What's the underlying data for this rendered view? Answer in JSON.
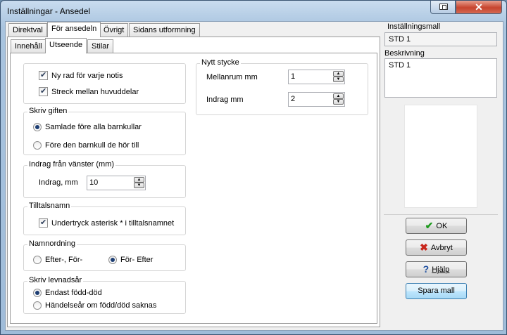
{
  "window": {
    "title": "Inställningar - Ansedel"
  },
  "tabs_top": [
    "Direktval",
    "För ansedeln",
    "Övrigt",
    "Sidans utformning"
  ],
  "tabs_sub": [
    "Innehåll",
    "Utseende",
    "Stilar"
  ],
  "general": {
    "new_row": "Ny rad för varje notis",
    "separator": "Streck mellan huvuddelar"
  },
  "skriv_giften": {
    "legend": "Skriv giften",
    "opt1": "Samlade före alla barnkullar",
    "opt2": "Före den barnkull de hör till"
  },
  "indrag_vanster": {
    "legend": "Indrag från vänster (mm)",
    "label": "Indrag, mm",
    "value": "10"
  },
  "tilltalsnamn": {
    "legend": "Tilltalsnamn",
    "check": "Undertryck asterisk * i tilltalsnamnet"
  },
  "namnordning": {
    "legend": "Namnordning",
    "opt1": "Efter-, För-",
    "opt2": "För- Efter"
  },
  "levnadsar": {
    "legend": "Skriv levnadsår",
    "opt1": "Endast född-död",
    "opt2": "Händelseår om född/död saknas"
  },
  "nytt_stycke": {
    "legend": "Nytt stycke",
    "mellanrum_label": "Mellanrum mm",
    "mellanrum_value": "1",
    "indrag_label": "Indrag mm",
    "indrag_value": "2"
  },
  "right": {
    "mall_label": "Inställningsmall",
    "mall_value": "STD 1",
    "beskrivning_label": "Beskrivning",
    "beskrivning_value": "STD 1"
  },
  "buttons": {
    "ok": "OK",
    "cancel": "Avbryt",
    "help": "Hjälp",
    "save": "Spara mall"
  },
  "colors": {
    "ok_icon": "#1f9b1f",
    "cancel_icon": "#c8261c",
    "help_icon": "#1f4fa0"
  }
}
